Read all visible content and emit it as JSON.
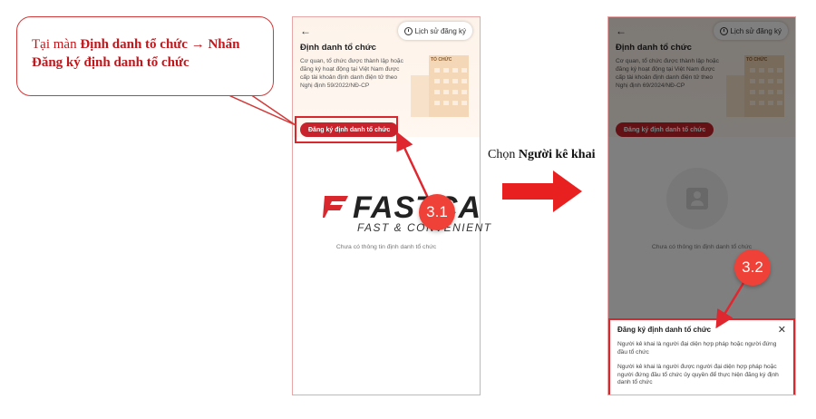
{
  "callout": {
    "text_1": "Tại màn ",
    "text_bold_1": "Định danh tổ chức",
    "arrow_text": " → ",
    "text_bold_2": "Nhấn Đăng ký định danh tổ chức"
  },
  "step": {
    "prefix": "Chọn ",
    "bold": "Người kê khai"
  },
  "left_screen": {
    "back": "←",
    "history_label": "Lịch sử đăng ký",
    "title": "Định danh tổ chức",
    "description": "Cơ quan, tổ chức được thành lập hoặc đăng ký hoạt động tại Việt Nam được cấp tài khoản định danh điện tử theo Nghị định 59/2022/NĐ-CP",
    "building_sign": "TỔ CHỨC",
    "register_button": "Đăng ký định danh tổ chức",
    "empty_text": "Chưa có thông tin định danh tổ chức"
  },
  "right_screen": {
    "back": "←",
    "history_label": "Lịch sử đăng ký",
    "title": "Định danh tổ chức",
    "description": "Cơ quan, tổ chức được thành lập hoặc đăng ký hoạt động tại Việt Nam được cấp tài khoản định danh điện tử theo Nghị định 69/2024/NĐ-CP",
    "building_sign": "TỔ CHỨC",
    "register_button": "Đăng ký định danh tổ chức",
    "empty_text": "Chưa có thông tin định danh tổ chức",
    "sheet": {
      "title": "Đăng ký định danh tổ chức",
      "close": "✕",
      "option_1": "Người kê khai là người đại diện hợp pháp hoặc người đứng đầu tổ chức",
      "option_2": "Người kê khai là người được người đại diện hợp pháp hoặc người đứng đầu tổ chức ủy quyền để thực hiện đăng ký định danh tổ chức"
    }
  },
  "badges": {
    "step_1": "3.1",
    "step_2": "3.2"
  },
  "watermark": {
    "brand": "FASTCA",
    "tagline": "FAST & CONVENIENT"
  },
  "colors": {
    "accent_red": "#c8232c",
    "badge_red": "#ef4137",
    "callout_text": "#c0171c"
  }
}
